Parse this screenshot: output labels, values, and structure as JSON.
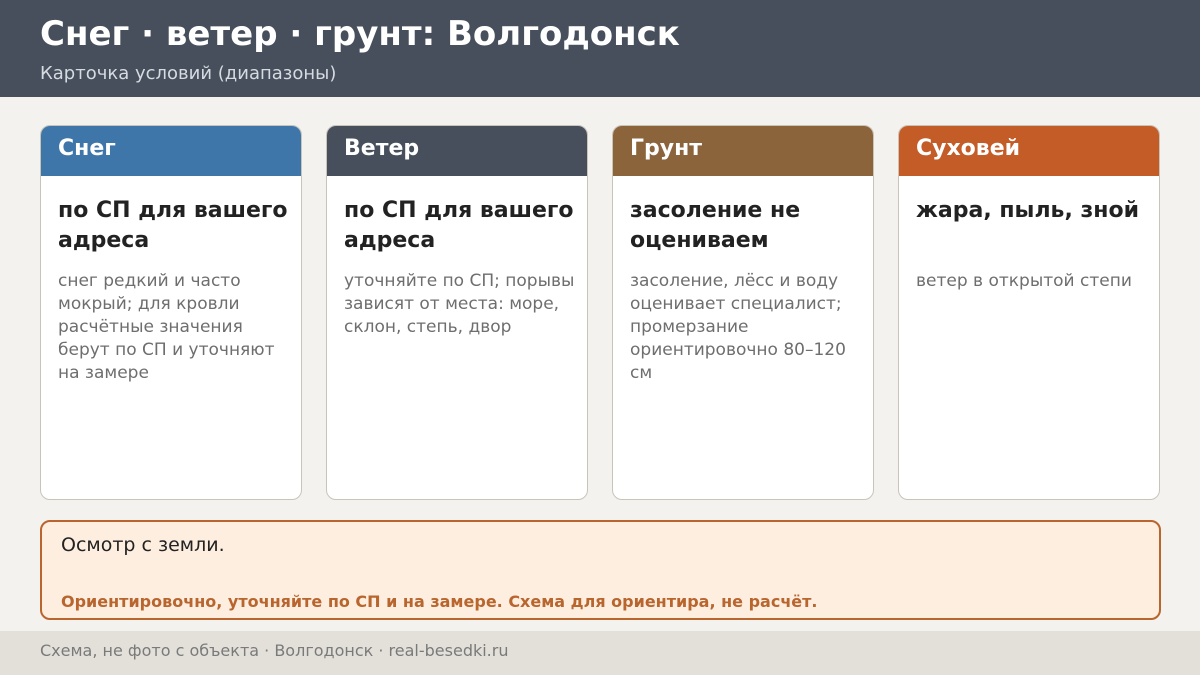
{
  "header": {
    "title": "Снег · ветер · грунт: Волгодонск",
    "subtitle": "Карточка условий (диапазоны)"
  },
  "cards": [
    {
      "title": "Снег",
      "color": "#3f76aa",
      "main": "по СП для вашего адреса",
      "desc": "снег редкий и часто мокрый; для кровли расчётные значения берут по СП и уточняют на замере"
    },
    {
      "title": "Ветер",
      "color": "#464f5b",
      "main": "по СП для вашего адреса",
      "desc": "уточняйте по СП; порывы зависят от места: море, склон, степь, двор"
    },
    {
      "title": "Грунт",
      "color": "#8b643c",
      "main": "засоление не оцениваем",
      "desc": "засоление, лёсс и воду оценивает специалист; промерзание ориентировочно 80–120 см"
    },
    {
      "title": "Суховей",
      "color": "#c45c27",
      "main": "жара, пыль, зной",
      "desc": "ветер в открытой степи"
    }
  ],
  "note": {
    "text": "Осмотр с земли.",
    "warning": "Ориентировочно, уточняйте по СП и на замере. Схема для ориентира, не расчёт."
  },
  "footer": {
    "text": "Схема, не фото с объекта  ·  Волгодонск  ·  real-besedki.ru"
  }
}
